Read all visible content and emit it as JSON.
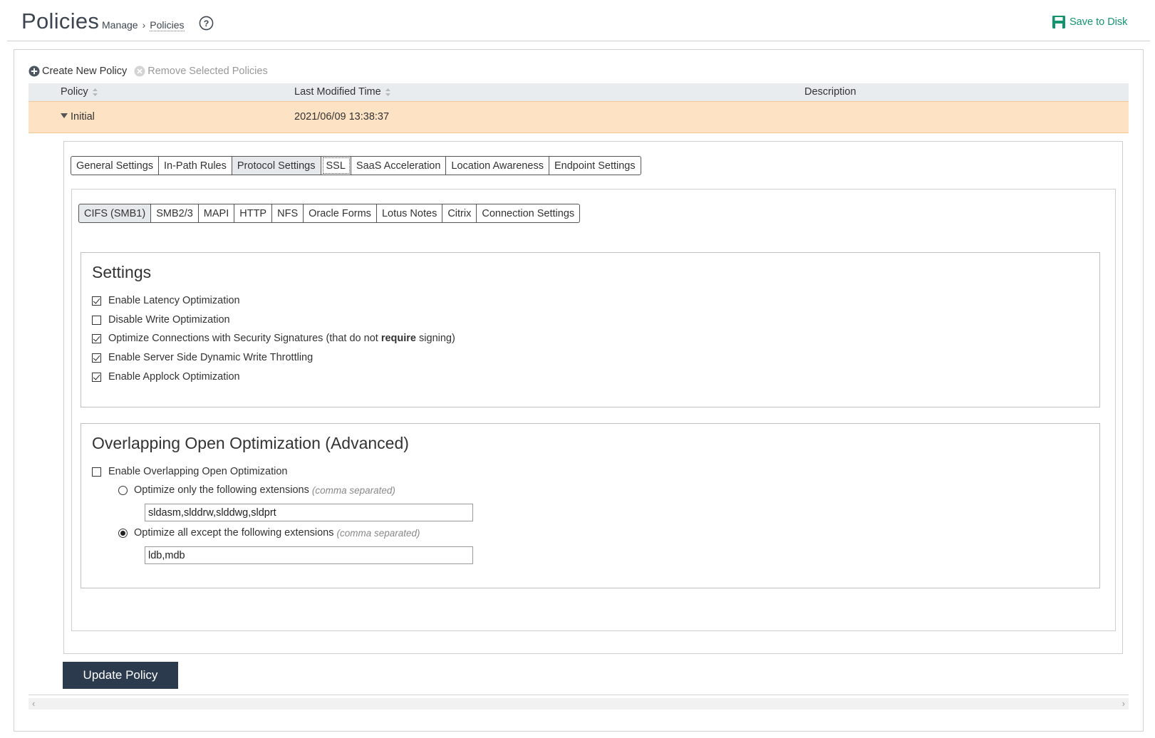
{
  "header": {
    "title": "Policies",
    "breadcrumb": [
      "Manage",
      "Policies"
    ],
    "save_label": "Save to Disk"
  },
  "actions": {
    "create": "Create New Policy",
    "remove": "Remove Selected Policies"
  },
  "table": {
    "columns": [
      "Policy",
      "Last Modified Time",
      "Description"
    ],
    "rows": [
      {
        "policy": "Initial",
        "modified": "2021/06/09 13:38:37",
        "description": ""
      }
    ]
  },
  "main_tabs": [
    "General Settings",
    "In-Path Rules",
    "Protocol Settings",
    "SSL",
    "SaaS Acceleration",
    "Location Awareness",
    "Endpoint Settings"
  ],
  "main_tab_active": "Protocol Settings",
  "sub_tabs": [
    "CIFS (SMB1)",
    "SMB2/3",
    "MAPI",
    "HTTP",
    "NFS",
    "Oracle Forms",
    "Lotus Notes",
    "Citrix",
    "Connection Settings"
  ],
  "sub_tab_active": "CIFS (SMB1)",
  "settings": {
    "title": "Settings",
    "options": [
      {
        "label": "Enable Latency Optimization",
        "checked": true
      },
      {
        "label": "Disable Write Optimization",
        "checked": false
      },
      {
        "label_pre": "Optimize Connections with Security Signatures (that do not ",
        "label_bold": "require",
        "label_post": " signing)",
        "checked": true
      },
      {
        "label": "Enable Server Side Dynamic Write Throttling",
        "checked": true
      },
      {
        "label": "Enable Applock Optimization",
        "checked": true
      }
    ]
  },
  "overlap": {
    "title": "Overlapping Open Optimization (Advanced)",
    "enable_label": "Enable Overlapping Open Optimization",
    "enable_checked": false,
    "only_label": "Optimize only the following extensions",
    "only_hint": "(comma separated)",
    "only_value": "sldasm,slddrw,slddwg,sldprt",
    "except_label": "Optimize all except the following extensions",
    "except_hint": "(comma separated)",
    "except_value": "ldb,mdb",
    "selected": "except"
  },
  "update_button": "Update Policy",
  "colors": {
    "accent": "#13946f",
    "selected_row": "#fde3c4",
    "button_bg": "#2b3a4d"
  }
}
